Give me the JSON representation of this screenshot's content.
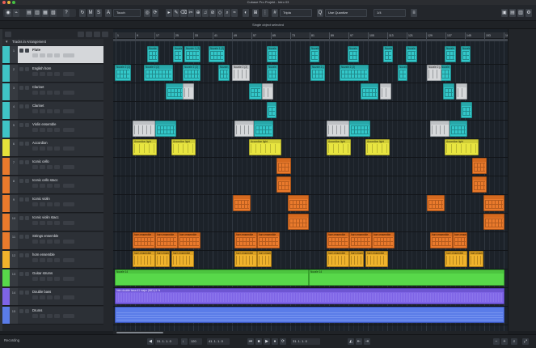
{
  "window": {
    "title": "Cubase Pro Projekt - Intro 03"
  },
  "toolbar": {
    "grid_label": "Touch",
    "snap_label": "Tripla",
    "quantize_label": "Use Quantize",
    "quantize_value": "1/4",
    "tools": [
      "▸",
      "✎",
      "⌫",
      "✂",
      "⊕",
      "♫",
      "⊘",
      "◇",
      "⌕",
      "≈"
    ]
  },
  "status": {
    "message": "Single object selected"
  },
  "left_zone": {
    "folder_name": "Tracks in Arrangement"
  },
  "tracks": [
    {
      "num": "1",
      "name": "Flute",
      "color": "#3fc4c6",
      "selected": true
    },
    {
      "num": "2",
      "name": "English horn",
      "color": "#3fc4c6"
    },
    {
      "num": "3",
      "name": "Clarinet",
      "color": "#3fc4c6"
    },
    {
      "num": "4",
      "name": "Clarinet",
      "color": "#3fc4c6"
    },
    {
      "num": "5",
      "name": "Violin ensemble",
      "color": "#3fc4c6"
    },
    {
      "num": "6",
      "name": "Accordion",
      "color": "#e4e23b"
    },
    {
      "num": "7",
      "name": "Iconic cello",
      "color": "#ea7a2c"
    },
    {
      "num": "8",
      "name": "Iconic cello stacc",
      "color": "#ea7a2c"
    },
    {
      "num": "9",
      "name": "Iconic violin",
      "color": "#ea7a2c"
    },
    {
      "num": "10",
      "name": "Iconic violin stacc",
      "color": "#ea7a2c"
    },
    {
      "num": "11",
      "name": "Strings ensemble",
      "color": "#ea7a2c"
    },
    {
      "num": "12",
      "name": "horn ensemble",
      "color": "#f0b32c"
    },
    {
      "num": "13",
      "name": "Guitar strums",
      "color": "#58d84a"
    },
    {
      "num": "14",
      "name": "Double bass",
      "color": "#7e64e6"
    },
    {
      "num": "15",
      "name": "Drums",
      "color": "#5a7ce8"
    }
  ],
  "ruler": {
    "marks": [
      "1",
      "9",
      "17",
      "25",
      "33",
      "41",
      "49",
      "57",
      "65",
      "73",
      "81",
      "89",
      "97",
      "105",
      "113",
      "121",
      "129",
      "137",
      "145",
      "153",
      "161"
    ]
  },
  "event_labels": {
    "flute": "Nozzle 1 (2)",
    "english_horn": "Nozzle 2 (2)",
    "accordion": "Accordion light",
    "strings": "horn ensemble",
    "horn": "horn ensemble",
    "guitar": "Nozzle 14",
    "bass": "Intro double bass A1 major (MIDI) 5 %"
  },
  "transport": {
    "label": "Recording",
    "position": "31. 1. 1. 0",
    "tempo": "120",
    "end": "41. 1. 1. 0"
  }
}
